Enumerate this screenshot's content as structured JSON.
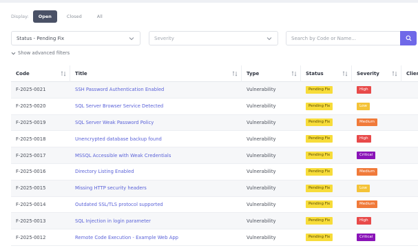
{
  "display": {
    "label": "Display:",
    "options": [
      "Open",
      "Closed",
      "All"
    ],
    "active": "Open"
  },
  "filters": {
    "status_value": "Status - Pending Fix",
    "severity_placeholder": "Severity",
    "search_placeholder": "Search by Code or Name..."
  },
  "advanced_filters_label": "Show advanced filters",
  "table": {
    "columns": [
      "Code",
      "Title",
      "Type",
      "Status",
      "Severity",
      "Clien"
    ],
    "rows": [
      {
        "code": "F-2025-0021",
        "title": "SSH Password Authentication Enabled",
        "type": "Vulnerability",
        "status": "Pending Fix",
        "severity": "High"
      },
      {
        "code": "F-2025-0020",
        "title": "SQL Server Browser Service Detected",
        "type": "Vulnerability",
        "status": "Pending Fix",
        "severity": "Low"
      },
      {
        "code": "F-2025-0019",
        "title": "SQL Server Weak Password Policy",
        "type": "Vulnerability",
        "status": "Pending Fix",
        "severity": "Medium"
      },
      {
        "code": "F-2025-0018",
        "title": "Unencrypted database backup found",
        "type": "Vulnerability",
        "status": "Pending Fix",
        "severity": "High"
      },
      {
        "code": "F-2025-0017",
        "title": "MSSQL Accessible with Weak Credentials",
        "type": "Vulnerability",
        "status": "Pending Fix",
        "severity": "Critical"
      },
      {
        "code": "F-2025-0016",
        "title": "Directory Listing Enabled",
        "type": "Vulnerability",
        "status": "Pending Fix",
        "severity": "Medium"
      },
      {
        "code": "F-2025-0015",
        "title": "Missing HTTP security headers",
        "type": "Vulnerability",
        "status": "Pending Fix",
        "severity": "Low"
      },
      {
        "code": "F-2025-0014",
        "title": "Outdated SSL/TLS protocol supported",
        "type": "Vulnerability",
        "status": "Pending Fix",
        "severity": "Medium"
      },
      {
        "code": "F-2025-0013",
        "title": "SQL Injection in login parameter",
        "type": "Vulnerability",
        "status": "Pending Fix",
        "severity": "High"
      },
      {
        "code": "F-2025-0012",
        "title": "Remote Code Execution - Example Web App",
        "type": "Vulnerability",
        "status": "Pending Fix",
        "severity": "Critical"
      }
    ]
  },
  "colors": {
    "accent": "#6f68e8",
    "active_toggle": "#4a5166",
    "link": "#5a62d8",
    "pending": "#f7dc3a",
    "high": "#e84a4a",
    "low": "#f4c338",
    "medium": "#f07a3a",
    "critical": "#8a14b8"
  },
  "icons": {
    "search": "search-icon",
    "chevron": "chevron-down-icon",
    "sort": "sort-icon"
  }
}
